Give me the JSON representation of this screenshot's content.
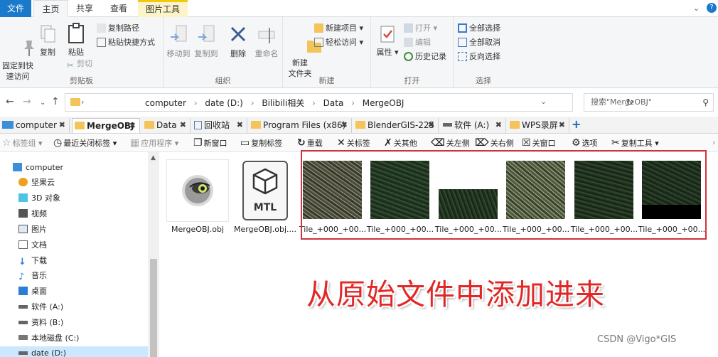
{
  "menu": {
    "file": "文件",
    "home": "主页",
    "share": "共享",
    "view": "查看",
    "picture_tools": "图片工具"
  },
  "ribbon": {
    "clipboard": {
      "pin": "固定到快\n速访问",
      "copy": "复制",
      "paste": "粘贴",
      "copy_path": "复制路径",
      "paste_shortcut": "粘贴快捷方式",
      "cut": "剪切",
      "label": "剪贴板"
    },
    "organize": {
      "move_to": "移动到",
      "copy_to": "复制到",
      "delete": "删除",
      "rename": "重命名",
      "label": "组织"
    },
    "new": {
      "new_folder": "新建\n文件夹",
      "new_item": "新建项目",
      "easy_access": "轻松访问",
      "label": "新建"
    },
    "open": {
      "properties": "属性",
      "open": "打开",
      "edit": "编辑",
      "history": "历史记录",
      "label": "打开"
    },
    "select": {
      "select_all": "全部选择",
      "select_none": "全部取消",
      "invert": "反向选择",
      "label": "选择"
    }
  },
  "address": {
    "crumbs": [
      "computer",
      "date (D:)",
      "Bilibili相关",
      "Data",
      "MergeOBJ"
    ],
    "search_placeholder": "搜索\"MergeOBJ\""
  },
  "tabs": [
    {
      "label": "computer",
      "active": false
    },
    {
      "label": "MergeOBJ",
      "active": true
    },
    {
      "label": "Data",
      "active": false
    },
    {
      "label": "回收站",
      "active": false
    },
    {
      "label": "Program Files (x86)",
      "active": false
    },
    {
      "label": "BlenderGIS-225",
      "active": false
    },
    {
      "label": "软件 (A:)",
      "active": false
    },
    {
      "label": "WPS录屏",
      "active": false
    }
  ],
  "toolbar": {
    "bookmark_group": "标签组",
    "recent_closed": "最近关闭标签",
    "apps": "应用程序",
    "new_window": "新窗口",
    "copy_tab": "复制标签",
    "reload": "重载",
    "close_tab": "关标签",
    "close_others": "关其他",
    "close_left": "关左侧",
    "close_right": "关右侧",
    "close_window": "关窗口",
    "options": "选项",
    "copy_tool": "复制工具"
  },
  "navpane": {
    "items": [
      "computer",
      "坚果云",
      "3D 对象",
      "视频",
      "图片",
      "文档",
      "下载",
      "音乐",
      "桌面",
      "软件 (A:)",
      "资料 (B:)",
      "本地磁盘 (C:)",
      "date (D:)"
    ]
  },
  "files": [
    {
      "name": "MergeOBJ.obj",
      "kind": "obj"
    },
    {
      "name": "MergeOBJ.obj....",
      "kind": "mtl"
    },
    {
      "name": "Tile_+000_+00...",
      "kind": "tile"
    },
    {
      "name": "Tile_+000_+00...",
      "kind": "tile"
    },
    {
      "name": "Tile_+000_+00...",
      "kind": "tile"
    },
    {
      "name": "Tile_+000_+00...",
      "kind": "tile"
    },
    {
      "name": "Tile_+000_+00...",
      "kind": "tile"
    },
    {
      "name": "Tile_+000_+00...",
      "kind": "tile"
    }
  ],
  "mtl_label": "MTL",
  "overlay_text": "从原始文件中添加进来",
  "watermark": "CSDN @Vigo*GIS",
  "colors": {
    "accent": "#1979ca",
    "highlight_box": "#d2323a",
    "overlay": "#e12828",
    "folder": "#f3c45a"
  }
}
